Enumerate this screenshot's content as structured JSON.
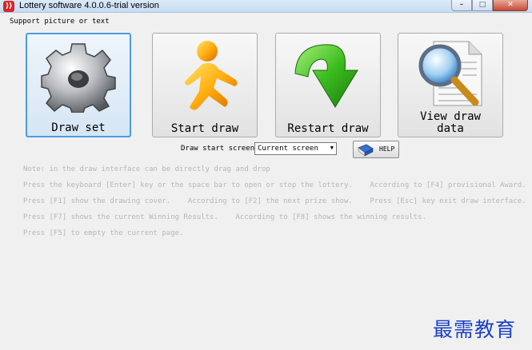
{
  "window": {
    "icon_glyph": "))",
    "title": "Lottery software 4.0.0.6-trial version",
    "controls": {
      "minimize": "–",
      "maximize": "□",
      "close": "✕"
    }
  },
  "caption": "Support picture or text",
  "tiles": [
    {
      "label": "Draw set",
      "icon": "gear-icon"
    },
    {
      "label": "Start draw",
      "icon": "running-man-icon"
    },
    {
      "label": "Restart draw",
      "icon": "green-arrow-icon"
    },
    {
      "label_line1": "View draw",
      "label_line2": "data",
      "icon": "magnifier-document-icon"
    }
  ],
  "draw_start": {
    "label": "Draw start screen",
    "value": "Current screen",
    "arrow": "▼"
  },
  "help": {
    "label": "HELP",
    "icon": "book-icon"
  },
  "notes": [
    "Note: in the draw interface can be directly drag and drop",
    "Press the keyboard [Enter] key or the space bar to open or stop the lottery.    According to [F4] provisional Award.",
    "Press [F1] show the drawing cover.    According to [F2] the next prize show.    Press [Esc] key exit draw interface.",
    "Press [F7] shows the current Winning Results.    According to [F8] shows the winning results.",
    "Press [F5] to empty the current page."
  ],
  "watermark": "最需教育",
  "colors": {
    "selected_border": "#4a9de0",
    "note_text": "#b6b6b6",
    "watermark": "#1b3fc9"
  }
}
